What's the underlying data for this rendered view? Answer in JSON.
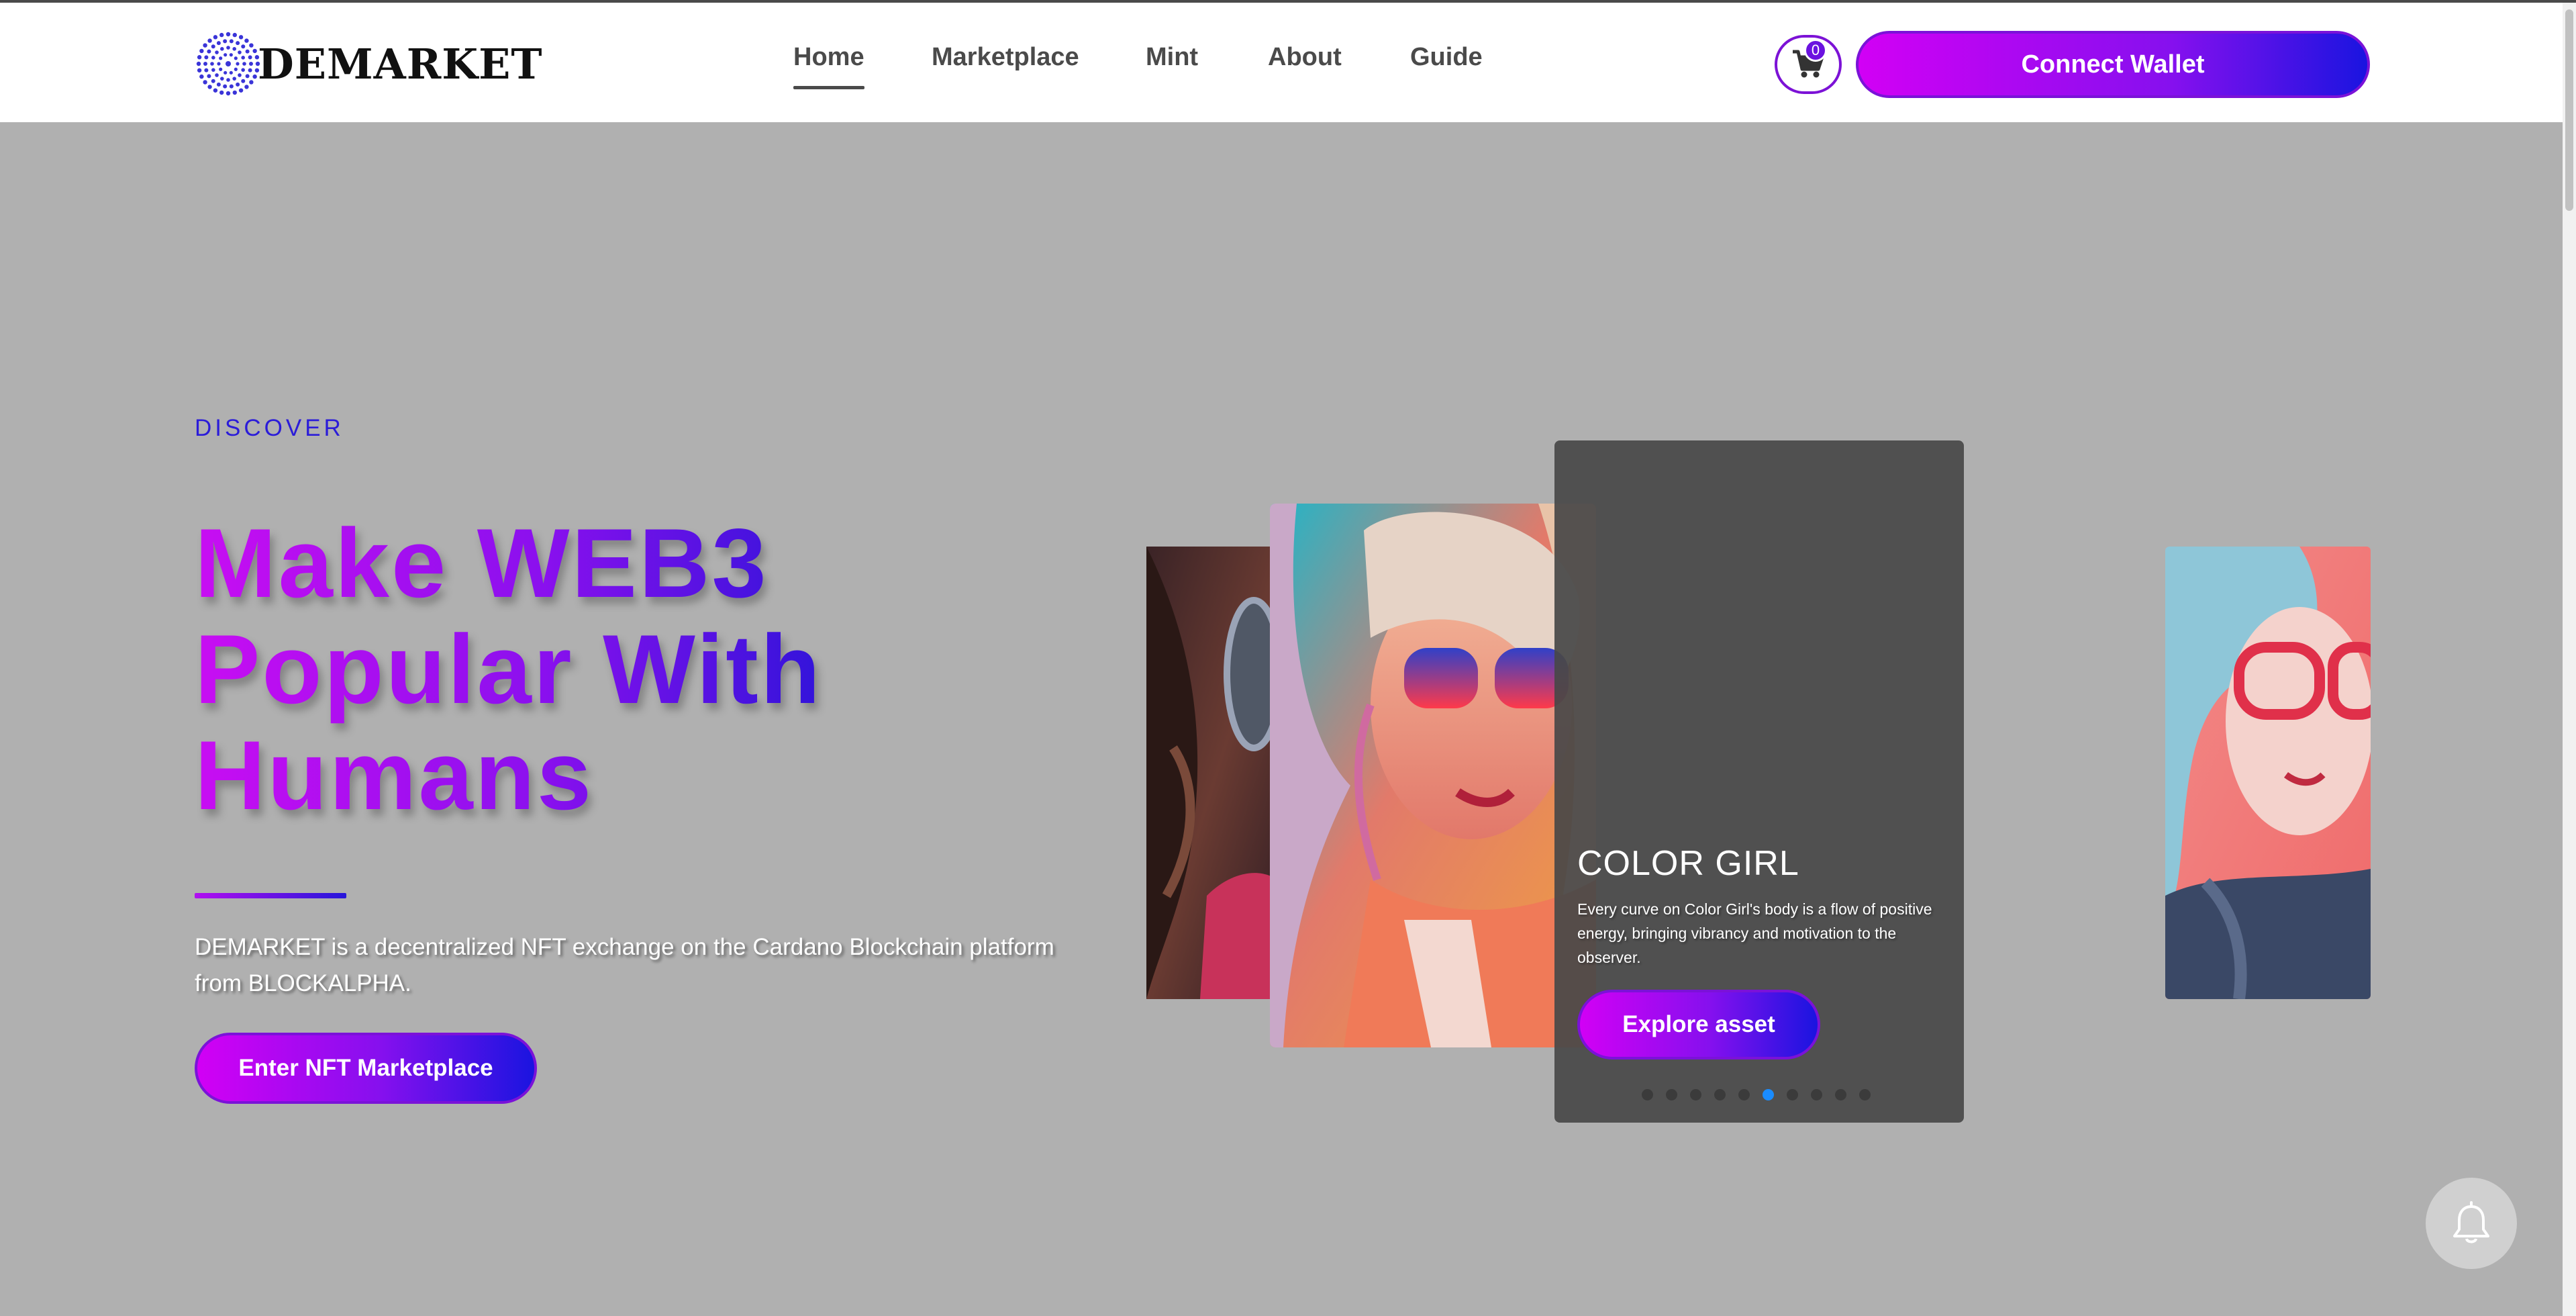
{
  "brand": {
    "name": "DEMARKET",
    "logo_icon": "dotted-circle-logo",
    "accent": "#8510ee",
    "gradient_start": "#d200f5",
    "gradient_end": "#1a14e0"
  },
  "nav": {
    "items": [
      {
        "label": "Home",
        "active": true
      },
      {
        "label": "Marketplace",
        "active": false
      },
      {
        "label": "Mint",
        "active": false
      },
      {
        "label": "About",
        "active": false
      },
      {
        "label": "Guide",
        "active": false
      }
    ]
  },
  "cart": {
    "icon": "cart-icon",
    "count": "0"
  },
  "connect_wallet": {
    "label": "Connect Wallet"
  },
  "hero": {
    "eyebrow": "DISCOVER",
    "headline_line1": "Make WEB3",
    "headline_line2": "Popular With",
    "headline_line3": "Humans",
    "description": "DEMARKET is a decentralized NFT exchange on the Cardano Blockchain platform from BLOCKALPHA.",
    "cta_label": "Enter NFT Marketplace"
  },
  "carousel": {
    "active_title": "COLOR GIRL",
    "active_description": "Every curve on Color Girl's body is a flow of positive energy, bringing vibrancy and motivation to the observer.",
    "explore_label": "Explore asset",
    "dot_count": 10,
    "active_index": 5
  },
  "notification": {
    "icon": "bell-icon"
  }
}
